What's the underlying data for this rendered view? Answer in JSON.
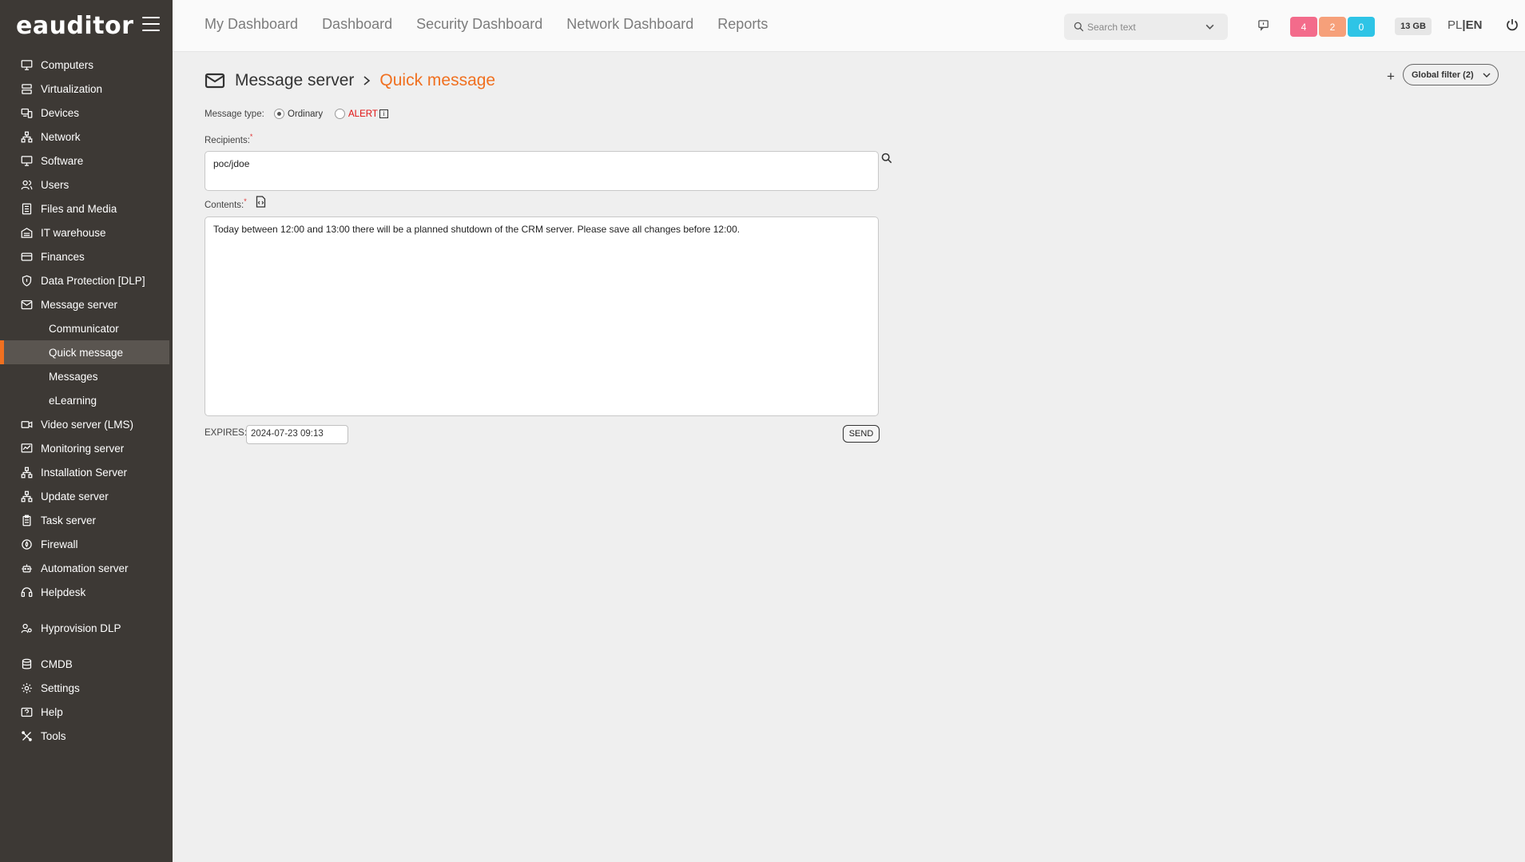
{
  "app": {
    "logo": "eauditor"
  },
  "sidebar": {
    "items": [
      {
        "label": "Computers",
        "icon": "monitor-icon"
      },
      {
        "label": "Virtualization",
        "icon": "server-icon"
      },
      {
        "label": "Devices",
        "icon": "devices-icon"
      },
      {
        "label": "Network",
        "icon": "network-icon"
      },
      {
        "label": "Software",
        "icon": "monitor-icon"
      },
      {
        "label": "Users",
        "icon": "users-icon"
      },
      {
        "label": "Files and Media",
        "icon": "files-icon"
      },
      {
        "label": "IT warehouse",
        "icon": "warehouse-icon"
      },
      {
        "label": "Finances",
        "icon": "card-icon"
      },
      {
        "label": "Data Protection [DLP]",
        "icon": "shield-icon"
      },
      {
        "label": "Message server",
        "icon": "mail-icon"
      },
      {
        "label": "Communicator",
        "sub": true
      },
      {
        "label": "Quick message",
        "sub": true,
        "active": true
      },
      {
        "label": "Messages",
        "sub": true
      },
      {
        "label": "eLearning",
        "sub": true
      },
      {
        "label": "Video server (LMS)",
        "icon": "video-icon"
      },
      {
        "label": "Monitoring server",
        "icon": "monitoring-icon"
      },
      {
        "label": "Installation Server",
        "icon": "network-icon"
      },
      {
        "label": "Update server",
        "icon": "network-icon"
      },
      {
        "label": "Task server",
        "icon": "clipboard-icon"
      },
      {
        "label": "Firewall",
        "icon": "fire-icon"
      },
      {
        "label": "Automation server",
        "icon": "robot-icon"
      },
      {
        "label": "Helpdesk",
        "icon": "helpdesk-icon"
      }
    ],
    "group2": [
      {
        "label": "Hyprovision DLP",
        "icon": "user-key-icon"
      }
    ],
    "group3": [
      {
        "label": "CMDB",
        "icon": "database-icon"
      },
      {
        "label": "Settings",
        "icon": "gear-icon"
      },
      {
        "label": "Help",
        "icon": "help-icon"
      },
      {
        "label": "Tools",
        "icon": "tools-icon"
      }
    ]
  },
  "topnav": [
    "My Dashboard",
    "Dashboard",
    "Security Dashboard",
    "Network Dashboard",
    "Reports"
  ],
  "search": {
    "placeholder": "Search text"
  },
  "badges": [
    {
      "value": "4",
      "color": "#f36b8b"
    },
    {
      "value": "2",
      "color": "#f6a07a"
    },
    {
      "value": "0",
      "color": "#2ec4e6"
    }
  ],
  "disk": "13 GB",
  "lang": {
    "pl": "PL",
    "sep": "|",
    "en": "EN"
  },
  "breadcrumb": {
    "parent": "Message server",
    "current": "Quick message"
  },
  "global_filter": {
    "plus": "+",
    "label": "Global filter (2)"
  },
  "form": {
    "message_type_label": "Message type:",
    "types": [
      "Ordinary",
      "ALERT"
    ],
    "selected_type": "Ordinary",
    "recipients_label": "Recipients:",
    "recipients_value": "poc/jdoe",
    "contents_label": "Contents:",
    "contents_value": "Today between 12:00 and 13:00 there will be a planned shutdown of the CRM server. Please save all changes before 12:00.",
    "expires_label": "EXPIRES:",
    "expires_value": "2024-07-23 09:13",
    "send_label": "SEND"
  },
  "colors": {
    "accent": "#f07020",
    "sidebar_bg": "#3d3935",
    "alert": "#e01010"
  }
}
